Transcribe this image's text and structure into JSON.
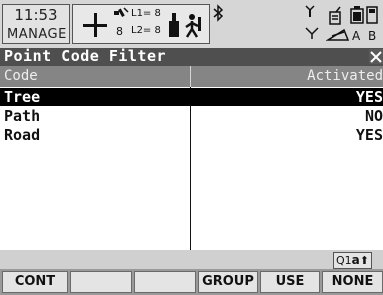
{
  "status": {
    "time": "11:53",
    "program": "MANAGE",
    "satellites": "8",
    "l1_label": "L1= 8",
    "l2_label": "L2= 8",
    "indicator_a": "A",
    "indicator_b": "B",
    "icons": [
      "position-crosshair-icon",
      "satellite-icon",
      "antenna-icon",
      "walking-person-icon",
      "bluetooth-icon",
      "radio-link-icon",
      "gsm-phone-icon",
      "battery-icon",
      "memory-card-icon",
      "compensator-icon"
    ]
  },
  "window": {
    "title": "Point Code Filter",
    "close_label": "✕"
  },
  "table": {
    "headers": {
      "code": "Code",
      "activated": "Activated"
    },
    "rows": [
      {
        "code": "Tree",
        "activated": "YES",
        "selected": true
      },
      {
        "code": "Path",
        "activated": "NO",
        "selected": false
      },
      {
        "code": "Road",
        "activated": "YES",
        "selected": false
      }
    ]
  },
  "input_mode": {
    "prefix": "Q1",
    "letter": "a",
    "arrow": "⬆"
  },
  "function_keys": [
    {
      "label": "CONT"
    },
    {
      "label": ""
    },
    {
      "label": ""
    },
    {
      "label": "GROUP"
    },
    {
      "label": "USE"
    },
    {
      "label": "NONE"
    }
  ],
  "colors": {
    "title_bar": "#4f4f4f",
    "header_bar": "#858585",
    "selection": "#000000",
    "background": "#d6d6d6"
  }
}
